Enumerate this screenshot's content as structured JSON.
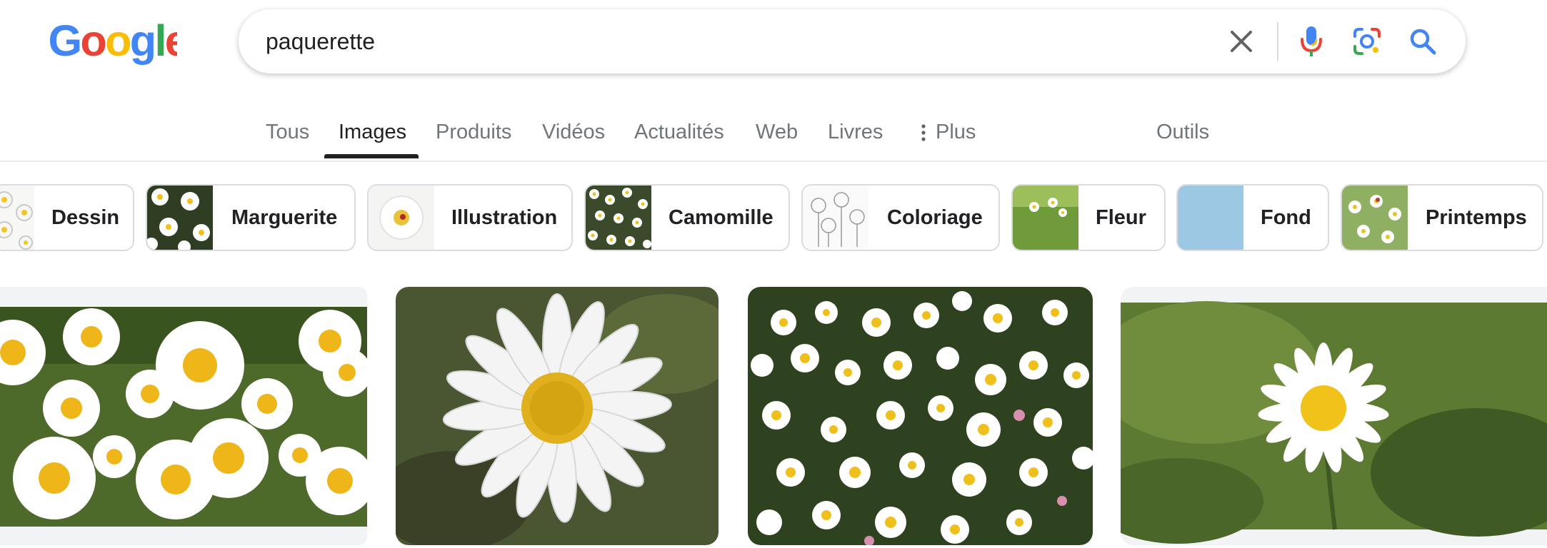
{
  "logo_text": "Google",
  "search": {
    "query": "paquerette",
    "icons": [
      "clear-icon",
      "microphone-icon",
      "camera-lens-icon",
      "search-icon"
    ]
  },
  "tabs": [
    {
      "label": "Tous"
    },
    {
      "label": "Images",
      "active": true
    },
    {
      "label": "Produits"
    },
    {
      "label": "Vidéos"
    },
    {
      "label": "Actualités"
    },
    {
      "label": "Web"
    },
    {
      "label": "Livres"
    },
    {
      "label": "Plus"
    }
  ],
  "tools_label": "Outils",
  "chips": [
    {
      "label": "Dessin"
    },
    {
      "label": "Marguerite"
    },
    {
      "label": "Illustration"
    },
    {
      "label": "Camomille"
    },
    {
      "label": "Coloriage"
    },
    {
      "label": "Fleur"
    },
    {
      "label": "Fond"
    },
    {
      "label": "Printemps"
    }
  ],
  "colors": {
    "accent": "#202124",
    "muted_text": "#70757a",
    "chip_border": "#dadce0",
    "logo_blue": "#4285F4",
    "logo_red": "#EA4335",
    "logo_yellow": "#FBBC05",
    "logo_green": "#34A853"
  }
}
